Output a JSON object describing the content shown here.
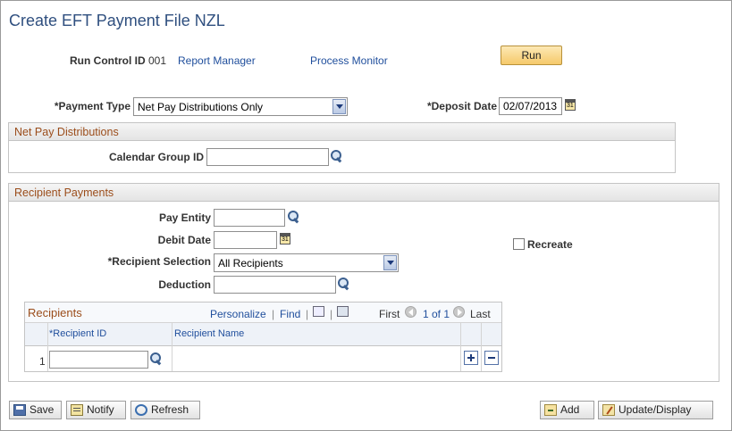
{
  "page": {
    "title": "Create EFT Payment File NZL"
  },
  "run_control": {
    "label": "Run Control ID",
    "value": "001",
    "report_manager": "Report Manager",
    "process_monitor": "Process Monitor",
    "run_button": "Run"
  },
  "payment_type": {
    "label": "*Payment Type",
    "value": "Net Pay Distributions Only"
  },
  "deposit_date": {
    "label": "*Deposit Date",
    "value": "02/07/2013"
  },
  "net_pay": {
    "header": "Net Pay Distributions",
    "calendar_group_label": "Calendar Group ID",
    "calendar_group_value": ""
  },
  "recipient_payments": {
    "header": "Recipient Payments",
    "pay_entity_label": "Pay Entity",
    "pay_entity_value": "",
    "debit_date_label": "Debit Date",
    "debit_date_value": "",
    "recipient_selection_label": "*Recipient Selection",
    "recipient_selection_value": "All Recipients",
    "deduction_label": "Deduction",
    "deduction_value": "",
    "recreate_label": "Recreate",
    "recreate_checked": false
  },
  "recipients_grid": {
    "title": "Recipients",
    "personalize": "Personalize",
    "separator1": "|",
    "find": "Find",
    "separator2": "|",
    "first": "First",
    "range": "1 of 1",
    "last": "Last",
    "columns": [
      "*Recipient ID",
      "Recipient Name"
    ],
    "rows": [
      {
        "index": "1",
        "recipient_id": "",
        "recipient_name": ""
      }
    ]
  },
  "footer": {
    "save": "Save",
    "notify": "Notify",
    "refresh": "Refresh",
    "add": "Add",
    "update_display": "Update/Display"
  }
}
